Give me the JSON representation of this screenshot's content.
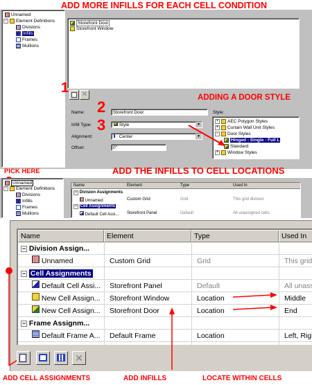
{
  "captions": {
    "top": "ADD MORE INFILLS FOR EACH CELL CONDITION",
    "adding_door": "ADDING A DOOR STYLE",
    "pick_here": "PICK HERE",
    "add_to_cells": "ADD THE INFILLS TO CELL LOCATIONS",
    "add_cell_assignments": "ADD CELL ASSIGNMENTS",
    "add_infills": "ADD INFILLS",
    "locate_within_cells": "LOCATE WITHIN CELLS",
    "step1": "1",
    "step2": "2",
    "step3": "3"
  },
  "top_tree": {
    "items": [
      "Unnamed",
      "Element Definitions",
      "Divisions",
      "Infills",
      "Frames",
      "Mullions"
    ]
  },
  "infill_list": [
    "Storefront Door",
    "Storefront Window"
  ],
  "props": {
    "name_label": "Name:",
    "name_value": "Storefront Door",
    "infill_type_label": "Infill Type:",
    "infill_type_value": "Style",
    "alignment_label": "Alignment:",
    "alignment_value": "Center",
    "offset_label": "Offset:",
    "offset_value": "0\"",
    "style_label": "Style:"
  },
  "style_tree": [
    "AEC Polygon Styles",
    "Curtain Wall Unit Styles",
    "Door Styles",
    "Hinged - Single - Full L",
    "Standard",
    "Window Styles"
  ],
  "mid_tree": {
    "items": [
      "Unnamed",
      "Element Definitions",
      "Divisions",
      "Infills",
      "Frames",
      "Mullions"
    ]
  },
  "mid_grid": {
    "headers": [
      "Name",
      "Element",
      "Type",
      "Used In"
    ],
    "rows": [
      [
        "Division Assignments",
        "",
        "",
        ""
      ],
      [
        "Unnamed",
        "Custom Grid",
        "Grid",
        "This grid division"
      ],
      [
        "Cell Assignments",
        "",
        "",
        ""
      ],
      [
        "Default Cell Assi...",
        "Storefront Panel",
        "Default",
        "All unassigned cells"
      ]
    ]
  },
  "big_grid": {
    "headers": [
      "Name",
      "Element",
      "Type",
      "Used In"
    ],
    "rows": [
      {
        "name": "Division Assign...",
        "element": "",
        "type": "",
        "used": "",
        "group": true
      },
      {
        "name": "Unnamed",
        "element": "Custom Grid",
        "type": "Grid",
        "used": "This grid",
        "group": false
      },
      {
        "name": "Cell Assignments",
        "element": "",
        "type": "",
        "used": "",
        "group": true
      },
      {
        "name": "Default Cell Assi...",
        "element": "Storefront Panel",
        "type": "Default",
        "used": "All unass",
        "group": false
      },
      {
        "name": "New Cell Assign...",
        "element": "Storefront Window",
        "type": "Location",
        "used": "Middle",
        "group": false
      },
      {
        "name": "New Cell Assign...",
        "element": "Storefront Door",
        "type": "Location",
        "used": "End",
        "group": false
      },
      {
        "name": "Frame Assignm...",
        "element": "",
        "type": "",
        "used": "",
        "group": true
      },
      {
        "name": "Default Frame A...",
        "element": "Default Frame",
        "type": "Location",
        "used": "Left, Righ",
        "group": false
      }
    ]
  },
  "colors": {
    "annotation": "#ff0000",
    "selection": "#000080",
    "dialog": "#c0c0c0"
  }
}
